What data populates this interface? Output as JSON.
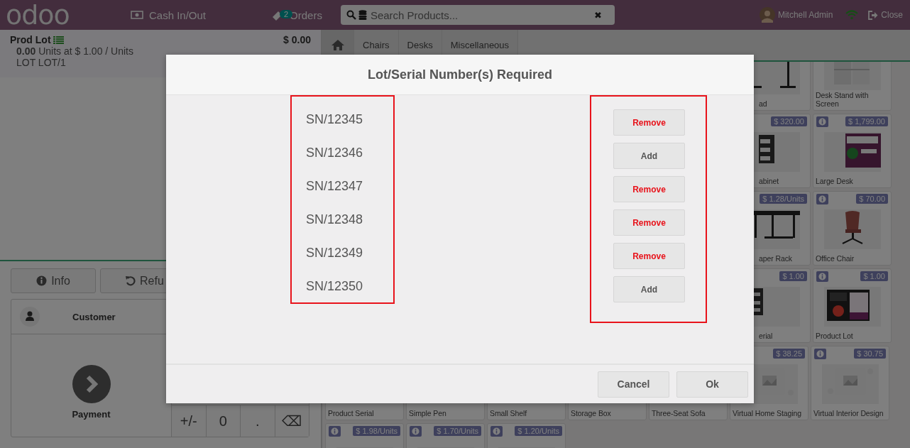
{
  "topbar": {
    "logo": "odoo",
    "cash": "Cash In/Out",
    "orders": {
      "label": "Orders",
      "count": "2"
    },
    "search": {
      "placeholder": "Search Products...",
      "clear": "✖"
    },
    "user": "Mitchell Admin",
    "close": "Close"
  },
  "order_line": {
    "name": "Prod Lot",
    "price": "$ 0.00",
    "qty": "0.00",
    "detail": "Units at $ 1.00 / Units",
    "lot": "LOT LOT/1"
  },
  "controls": [
    {
      "label": "Info",
      "kind": "info"
    },
    {
      "label": "Refu",
      "kind": "refund"
    }
  ],
  "customer": "Customer",
  "payment": "Payment",
  "numpad": [
    "+/-",
    "0",
    ".",
    "⌫"
  ],
  "categories": [
    "Chairs",
    "Desks",
    "Miscellaneous"
  ],
  "product_rows": [
    {
      "tiles": [
        {
          "name": "ad",
          "clipped": true,
          "image": true
        },
        {
          "name": "Desk Stand with Screen",
          "image": true
        }
      ]
    },
    {
      "tiles": [
        {
          "name": "abinet",
          "price": "$ 320.00",
          "clipped": true,
          "image": true
        },
        {
          "name": "Large Desk",
          "price": "$ 1,799.00",
          "info": true,
          "image": true
        }
      ]
    },
    {
      "tiles": [
        {
          "name": "aper Rack",
          "price": "$ 1.28/Units",
          "clipped": true,
          "image": true
        },
        {
          "name": "Office Chair",
          "price": "$ 70.00",
          "info": true,
          "image": true
        }
      ]
    },
    {
      "tiles": [
        {
          "name": "erial",
          "price": "$ 1.00",
          "clipped": true,
          "image": true
        },
        {
          "name": "Product Lot",
          "price": "$ 1.00",
          "info": true,
          "image": true
        }
      ]
    },
    {
      "tiles": [
        {
          "name": "Product Serial"
        },
        {
          "name": "Simple Pen"
        },
        {
          "name": "Small Shelf"
        },
        {
          "name": "Storage Box"
        },
        {
          "name": "Three-Seat Sofa"
        },
        {
          "name": "Virtual Home Staging",
          "price": "$ 38.25",
          "image": true
        },
        {
          "name": "Virtual Interior Design",
          "price": "$ 30.75",
          "info": true,
          "image": true
        }
      ]
    },
    {
      "tiles": [
        {
          "price": "$ 1.98/Units",
          "info": true,
          "image": true
        },
        {
          "price": "$ 1.70/Units",
          "info": true,
          "image": true
        },
        {
          "price": "$ 1.20/Units",
          "info": true,
          "image": true
        }
      ]
    }
  ],
  "modal": {
    "title": "Lot/Serial Number(s) Required",
    "serials": [
      "SN/12345",
      "SN/12346",
      "SN/12347",
      "SN/12348",
      "SN/12349",
      "SN/12350"
    ],
    "actions": [
      {
        "label": "Remove",
        "kind": "remove"
      },
      {
        "label": "Add",
        "kind": "add"
      },
      {
        "label": "Remove",
        "kind": "remove"
      },
      {
        "label": "Remove",
        "kind": "remove"
      },
      {
        "label": "Remove",
        "kind": "remove"
      },
      {
        "label": "Add",
        "kind": "add"
      }
    ],
    "buttons": [
      "Cancel",
      "Ok"
    ]
  }
}
